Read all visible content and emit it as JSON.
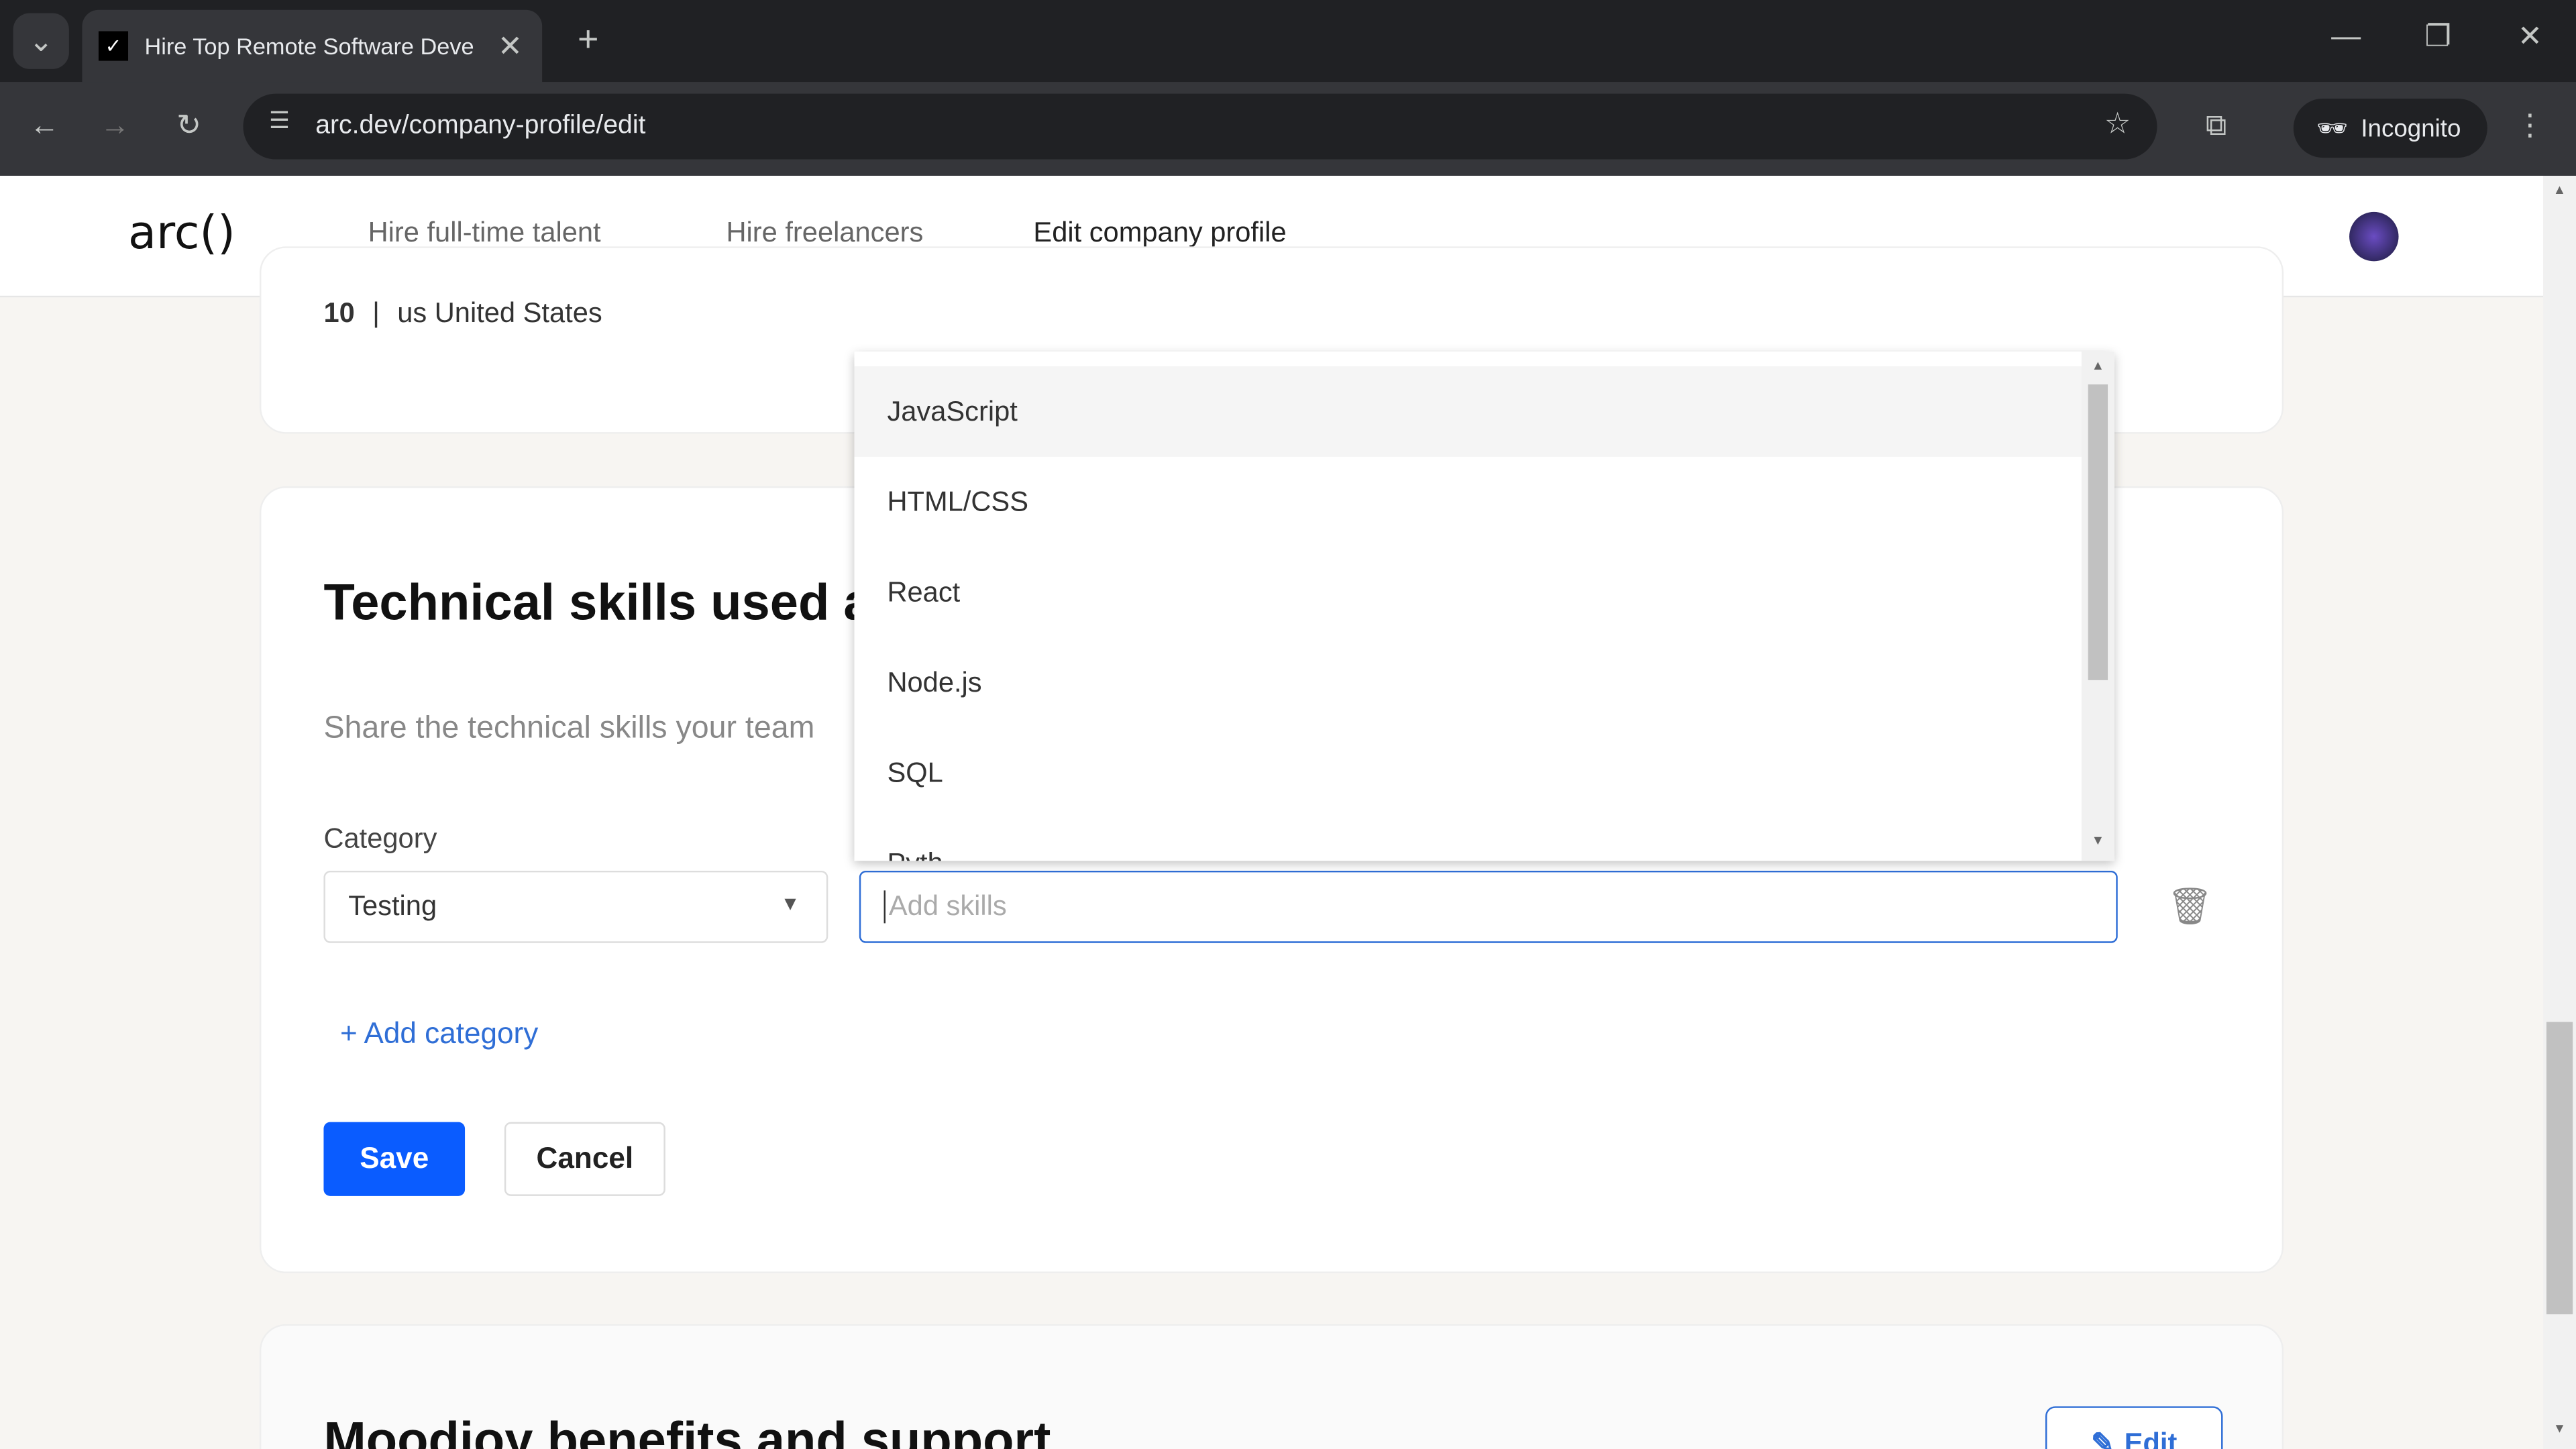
{
  "browser": {
    "tab_title": "Hire Top Remote Software Deve",
    "url": "arc.dev/company-profile/edit",
    "incognito_label": "Incognito"
  },
  "header": {
    "logo": "arc()",
    "links": [
      "Hire full-time talent",
      "Hire freelancers",
      "Edit company profile"
    ]
  },
  "top_card": {
    "info_count": "10",
    "separator": "|",
    "country": "us United States"
  },
  "skills_section": {
    "title": "Technical skills used a",
    "description": "Share the technical skills your team",
    "category_label": "Category",
    "category_value": "Testing",
    "skills_placeholder": "Add skills",
    "add_category": "+ Add category",
    "save": "Save",
    "cancel": "Cancel",
    "dropdown_options": [
      "JavaScript",
      "HTML/CSS",
      "React",
      "Node.js",
      "SQL",
      "Pyth"
    ]
  },
  "next_section": {
    "title": "Moodjoy benefits and support",
    "edit": "Edit"
  },
  "colors": {
    "primary": "#0a5cff",
    "link": "#2f6ed6"
  }
}
